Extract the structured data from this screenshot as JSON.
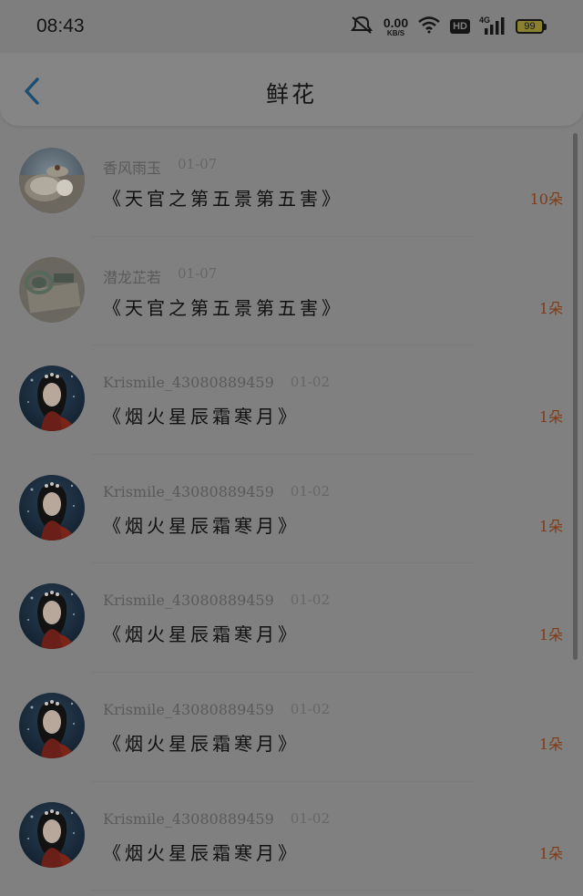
{
  "status_bar": {
    "time": "08:43",
    "net_speed_value": "0.00",
    "net_speed_unit": "KB/S",
    "hd_label": "HD",
    "signal_label": "4G",
    "battery": "99"
  },
  "header": {
    "title": "鲜花"
  },
  "gifts": [
    {
      "user": "香风雨玉",
      "date": "01-07",
      "work": "《天官之第五景第五害》",
      "count": "10朵",
      "avatar": "avatar-shells"
    },
    {
      "user": "潜龙芷若",
      "date": "01-07",
      "work": "《天官之第五景第五害》",
      "count": "1朵",
      "avatar": "avatar-jade"
    },
    {
      "user": "Krismile_43080889459",
      "date": "01-02",
      "work": "《烟火星辰霜寒月》",
      "count": "1朵",
      "avatar": "avatar-girl"
    },
    {
      "user": "Krismile_43080889459",
      "date": "01-02",
      "work": "《烟火星辰霜寒月》",
      "count": "1朵",
      "avatar": "avatar-girl"
    },
    {
      "user": "Krismile_43080889459",
      "date": "01-02",
      "work": "《烟火星辰霜寒月》",
      "count": "1朵",
      "avatar": "avatar-girl"
    },
    {
      "user": "Krismile_43080889459",
      "date": "01-02",
      "work": "《烟火星辰霜寒月》",
      "count": "1朵",
      "avatar": "avatar-girl"
    },
    {
      "user": "Krismile_43080889459",
      "date": "01-02",
      "work": "《烟火星辰霜寒月》",
      "count": "1朵",
      "avatar": "avatar-girl"
    }
  ],
  "colors": {
    "accent": "#1d4f73",
    "count": "#803b14"
  }
}
